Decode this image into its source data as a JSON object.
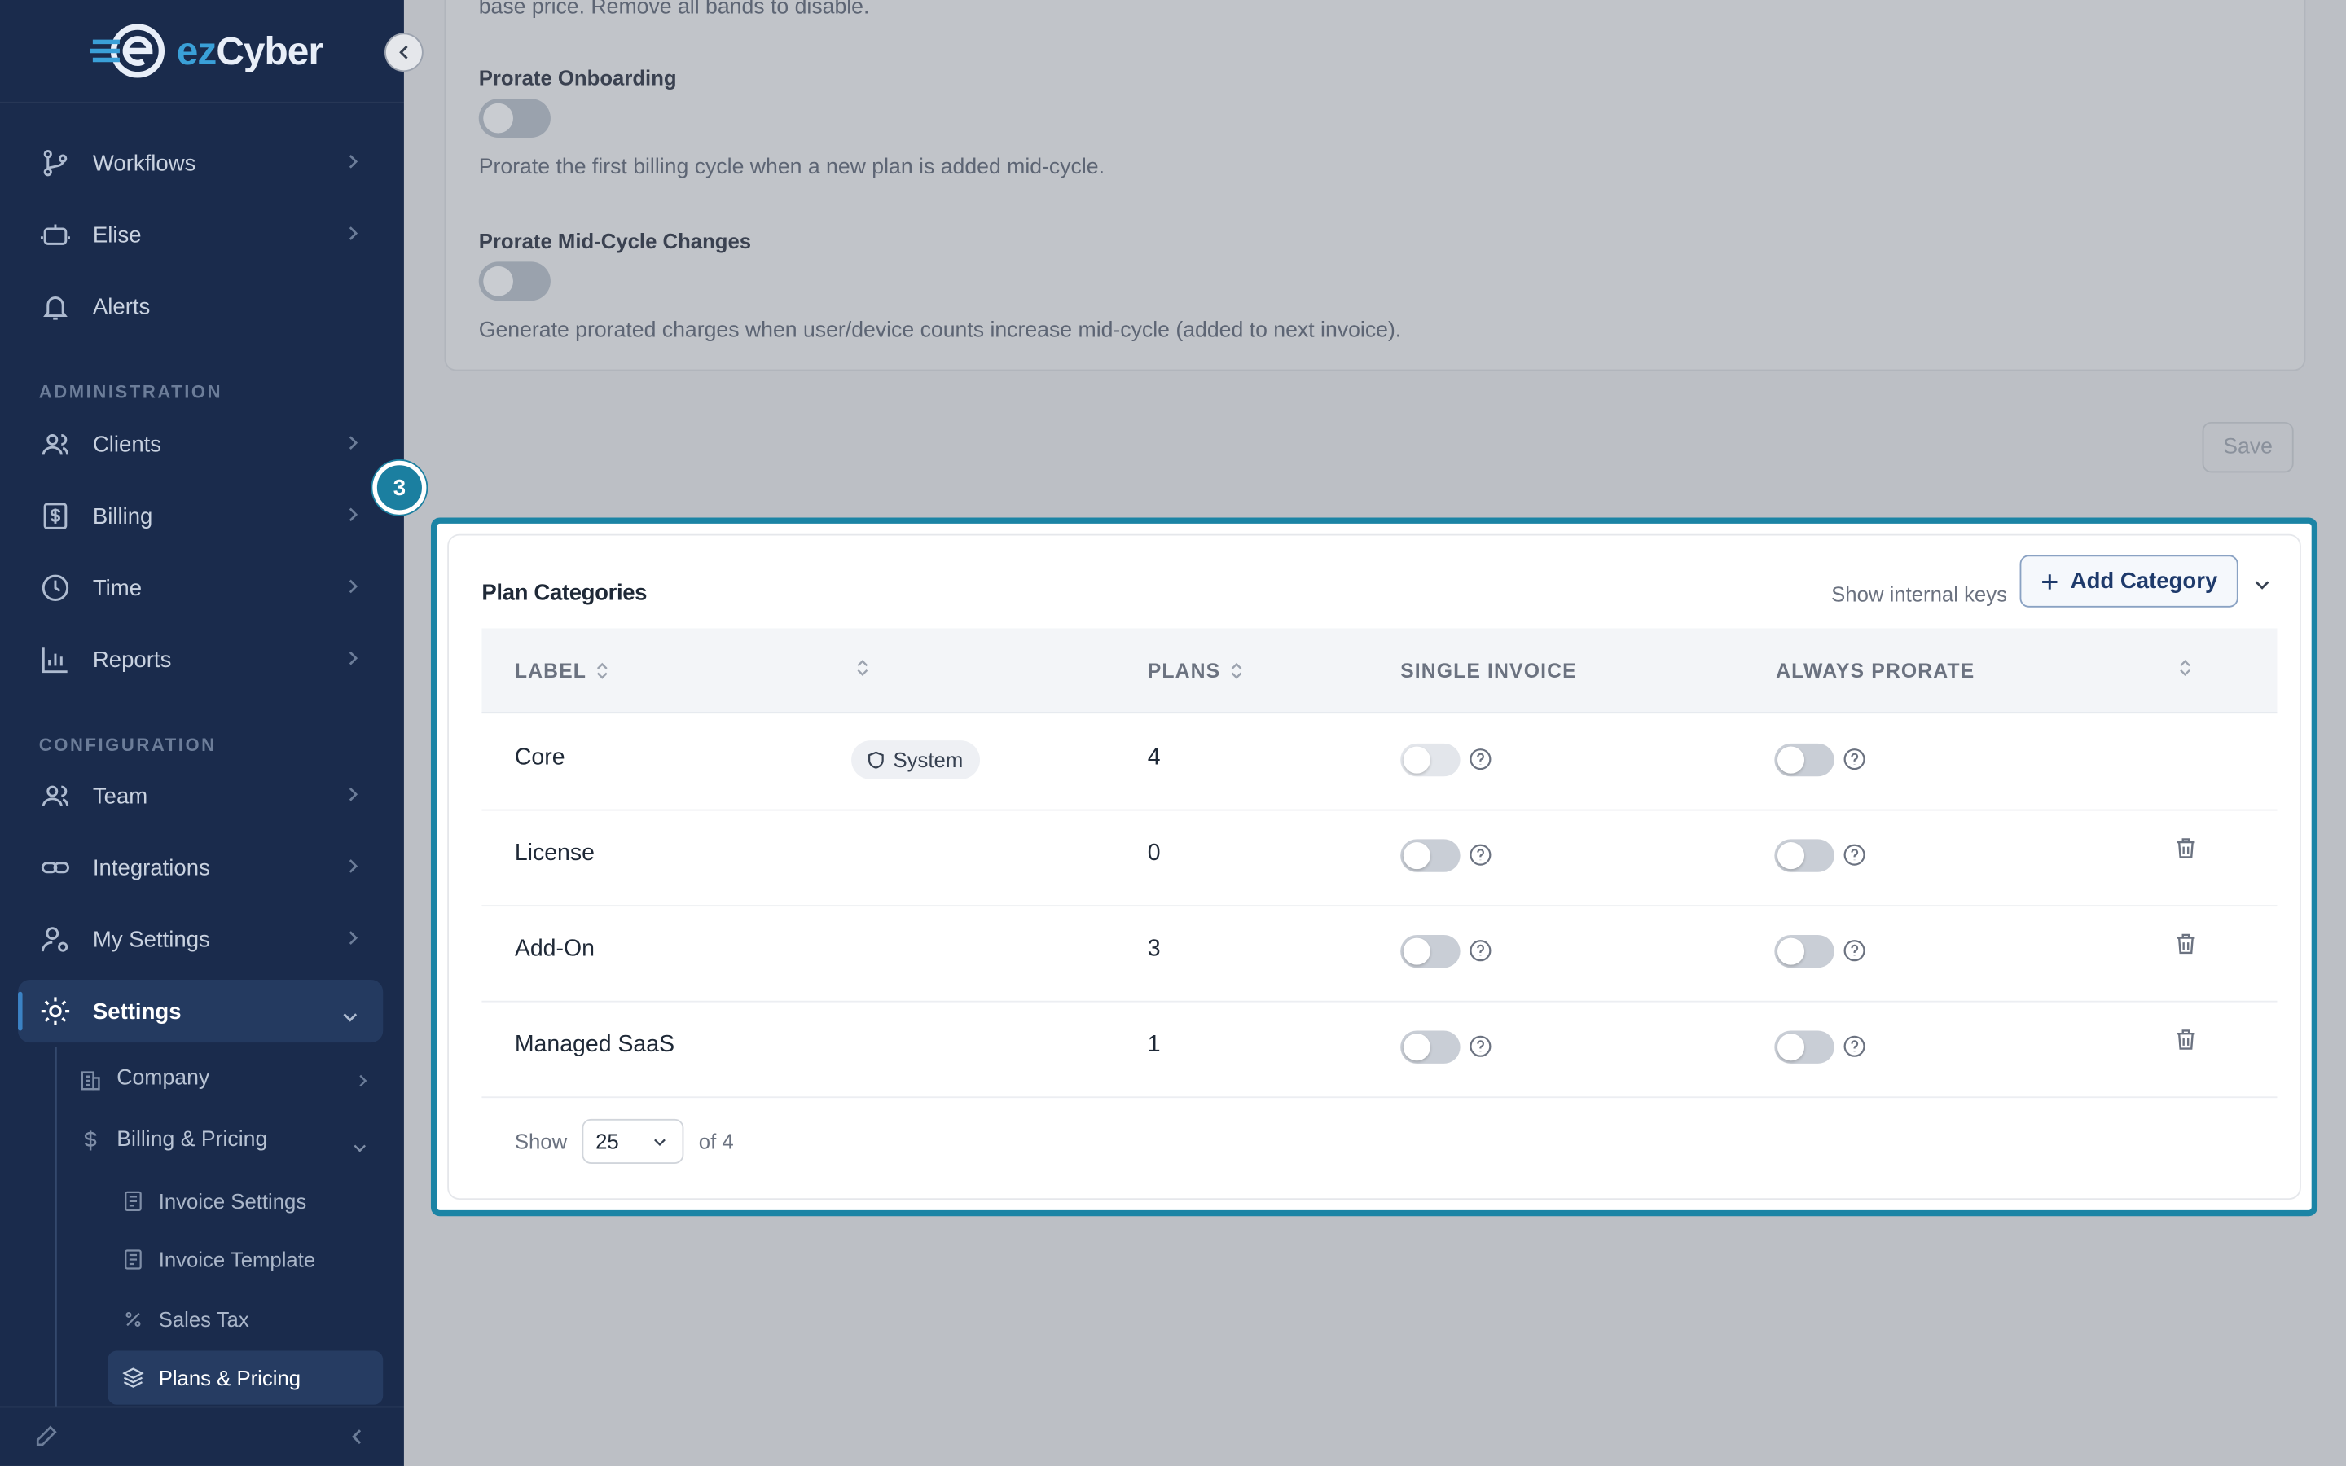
{
  "brand": {
    "logo_text_a": "ez",
    "logo_text_b": "Cyber"
  },
  "sidebar": {
    "items": [
      {
        "label": "Workflows",
        "icon": "workflow-icon"
      },
      {
        "label": "Elise",
        "icon": "robot-icon"
      },
      {
        "label": "Alerts",
        "icon": "bell-icon"
      }
    ],
    "sections": {
      "administration": "ADMINISTRATION",
      "configuration": "CONFIGURATION"
    },
    "admin_items": [
      {
        "label": "Clients",
        "icon": "users-icon"
      },
      {
        "label": "Billing",
        "icon": "receipt-icon"
      },
      {
        "label": "Time",
        "icon": "clock-icon"
      },
      {
        "label": "Reports",
        "icon": "bar-chart-icon"
      }
    ],
    "config_items": [
      {
        "label": "Team",
        "icon": "users-icon"
      },
      {
        "label": "Integrations",
        "icon": "link-icon"
      },
      {
        "label": "My Settings",
        "icon": "user-gear-icon"
      },
      {
        "label": "Settings",
        "icon": "gear-icon"
      }
    ],
    "settings_sub": [
      {
        "label": "Company",
        "icon": "building-icon"
      },
      {
        "label": "Billing & Pricing",
        "icon": "dollar-icon"
      }
    ],
    "billing_sub": [
      {
        "label": "Invoice Settings",
        "icon": "document-icon"
      },
      {
        "label": "Invoice Template",
        "icon": "document-icon"
      },
      {
        "label": "Sales Tax",
        "icon": "percent-icon"
      },
      {
        "label": "Plans & Pricing",
        "icon": "layers-icon"
      }
    ]
  },
  "top_card": {
    "clipped_text": "base price. Remove all bands to disable.",
    "prorate_onboarding_title": "Prorate Onboarding",
    "prorate_onboarding_desc": "Prorate the first billing cycle when a new plan is added mid-cycle.",
    "prorate_midcycle_title": "Prorate Mid-Cycle Changes",
    "prorate_midcycle_desc": "Generate prorated charges when user/device counts increase mid-cycle (added to next invoice)."
  },
  "save_label": "Save",
  "step_badge": "3",
  "plan_categories": {
    "title": "Plan Categories",
    "show_internal_keys": "Show internal keys",
    "add_label": "Add Category",
    "headers": {
      "label": "LABEL",
      "plans": "PLANS",
      "single_invoice": "SINGLE INVOICE",
      "always_prorate": "ALWAYS PRORATE"
    },
    "rows": [
      {
        "label": "Core",
        "badge": "System",
        "plans": "4",
        "single_invoice": false,
        "always_prorate": false,
        "deletable": false
      },
      {
        "label": "License",
        "badge": "",
        "plans": "0",
        "single_invoice": false,
        "always_prorate": false,
        "deletable": true
      },
      {
        "label": "Add-On",
        "badge": "",
        "plans": "3",
        "single_invoice": false,
        "always_prorate": false,
        "deletable": true
      },
      {
        "label": "Managed SaaS",
        "badge": "",
        "plans": "1",
        "single_invoice": false,
        "always_prorate": false,
        "deletable": true
      }
    ],
    "pager": {
      "show": "Show",
      "page_size": "25",
      "of_total": "of 4"
    }
  },
  "colors": {
    "sidebar_bg": "#1a2b4c",
    "accent": "#1b84a5",
    "overlay": "#bcbfc5"
  }
}
